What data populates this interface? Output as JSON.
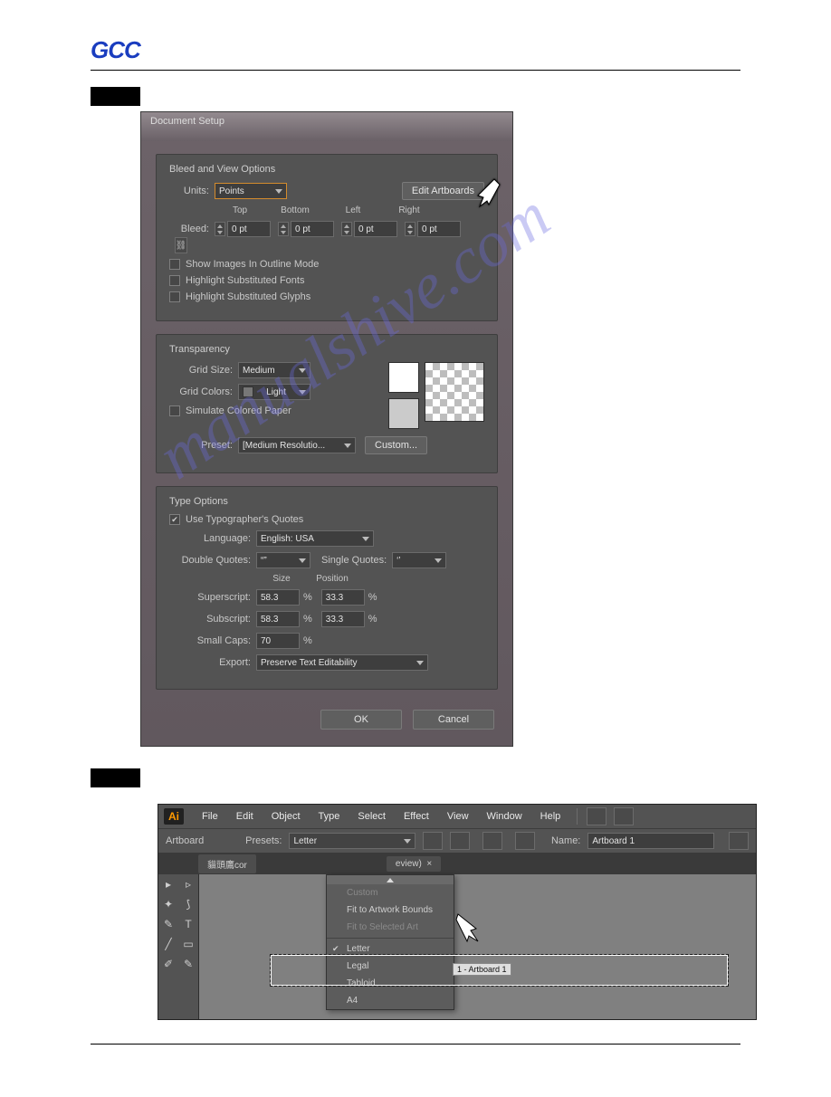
{
  "logo": "GCC",
  "fig1": {
    "title": "Document Setup",
    "bleedview": {
      "title": "Bleed and View Options",
      "units_label": "Units:",
      "units_value": "Points",
      "edit_artboards": "Edit Artboards",
      "cols": {
        "top": "Top",
        "bottom": "Bottom",
        "left": "Left",
        "right": "Right"
      },
      "bleed_label": "Bleed:",
      "bleed": {
        "top": "0 pt",
        "bottom": "0 pt",
        "left": "0 pt",
        "right": "0 pt"
      },
      "show_images": "Show Images In Outline Mode",
      "highlight_fonts": "Highlight Substituted Fonts",
      "highlight_glyphs": "Highlight Substituted Glyphs"
    },
    "transparency": {
      "title": "Transparency",
      "gridsize_label": "Grid Size:",
      "gridsize_value": "Medium",
      "gridcolors_label": "Grid Colors:",
      "gridcolors_value": "Light",
      "simulate": "Simulate Colored Paper",
      "preset_label": "Preset:",
      "preset_value": "[Medium Resolutio...",
      "custom_btn": "Custom..."
    },
    "type": {
      "title": "Type Options",
      "use_typographers": "Use Typographer's Quotes",
      "language_label": "Language:",
      "language_value": "English: USA",
      "double_label": "Double Quotes:",
      "double_value": "“”",
      "single_label": "Single Quotes:",
      "single_value": "‘’",
      "size_label": "Size",
      "position_label": "Position",
      "superscript_label": "Superscript:",
      "superscript_size": "58.3",
      "superscript_pos": "33.3",
      "percent": "%",
      "subscript_label": "Subscript:",
      "subscript_size": "58.3",
      "subscript_pos": "33.3",
      "smallcaps_label": "Small Caps:",
      "smallcaps_value": "70",
      "export_label": "Export:",
      "export_value": "Preserve Text Editability"
    },
    "ok": "OK",
    "cancel": "Cancel"
  },
  "fig2": {
    "menu": {
      "file": "File",
      "edit": "Edit",
      "object": "Object",
      "type": "Type",
      "select": "Select",
      "effect": "Effect",
      "view": "View",
      "window": "Window",
      "help": "Help"
    },
    "opt": {
      "panel": "Artboard",
      "presets_label": "Presets:",
      "presets_value": "Letter",
      "name_label": "Name:",
      "name_value": "Artboard 1"
    },
    "tab": {
      "doc": "貓頭鷹cor",
      "suffix": "eview)",
      "x": "×"
    },
    "dropdown": {
      "custom": "Custom",
      "fit_bounds": "Fit to Artwork Bounds",
      "fit_selected": "Fit to Selected Art",
      "letter": "Letter",
      "legal": "Legal",
      "tabloid": "Tabloid",
      "a4": "A4"
    },
    "ab_label": "1 - Artboard 1"
  },
  "watermark": "manualshive.com"
}
